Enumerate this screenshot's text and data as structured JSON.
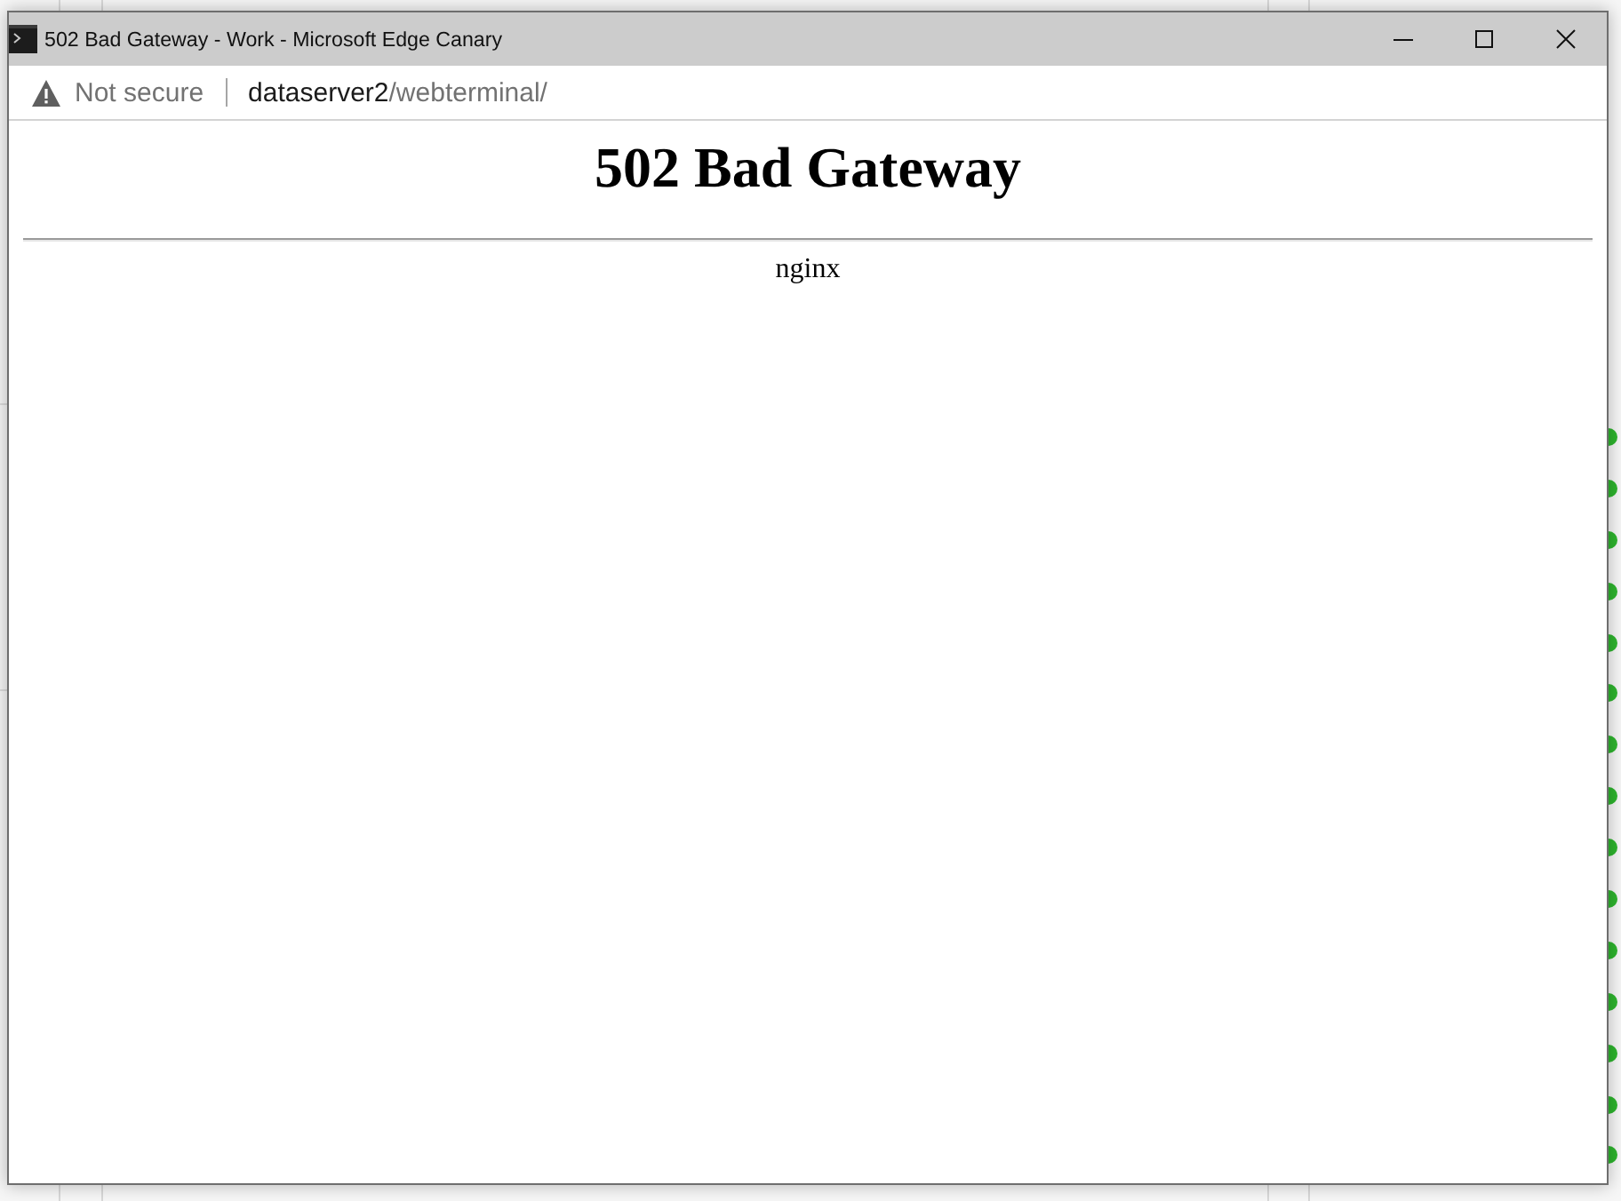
{
  "window": {
    "title": "502 Bad Gateway - Work - Microsoft Edge Canary"
  },
  "address_bar": {
    "security_label": "Not secure",
    "url": {
      "host": "dataserver2",
      "path": "/webterminal/"
    }
  },
  "page": {
    "heading": "502 Bad Gateway",
    "server": "nginx"
  }
}
